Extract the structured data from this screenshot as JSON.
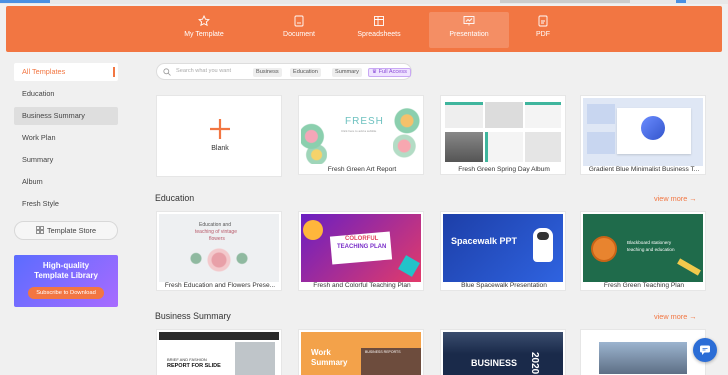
{
  "topbar": {
    "tabs": [
      {
        "label": "My Template",
        "icon": "star-icon"
      },
      {
        "label": "Document",
        "icon": "document-icon"
      },
      {
        "label": "Spreadsheets",
        "icon": "spreadsheet-icon"
      },
      {
        "label": "Presentation",
        "icon": "presentation-icon",
        "active": true
      },
      {
        "label": "PDF",
        "icon": "pdf-icon"
      }
    ],
    "color": "#f27642"
  },
  "sidebar": {
    "items": [
      {
        "label": "All Templates",
        "active": true
      },
      {
        "label": "Education"
      },
      {
        "label": "Business Summary",
        "hover": true
      },
      {
        "label": "Work Plan"
      },
      {
        "label": "Summary"
      },
      {
        "label": "Album"
      },
      {
        "label": "Fresh Style"
      }
    ],
    "store_label": "Template Store",
    "promo": {
      "line1": "High-quality",
      "line2": "Template Library",
      "button": "Subscribe to Download"
    }
  },
  "search": {
    "placeholder": "Search what you want",
    "chips": [
      "Business",
      "Education",
      "Summary"
    ],
    "full_access": "Full Access"
  },
  "row1": [
    {
      "caption": "Blank"
    },
    {
      "caption": "Fresh Green Art Report",
      "title": "FRESH",
      "sub": "Click here to add a subtitle"
    },
    {
      "caption": "Fresh Green Spring Day Album"
    },
    {
      "caption": "Gradient Blue Minimalist Business T..."
    }
  ],
  "education": {
    "title": "Education",
    "more": "view more",
    "cards": [
      {
        "caption": "Fresh Education and Flowers Prese...",
        "l1": "Education and",
        "l2": "teaching of vintage",
        "l3": "flowers"
      },
      {
        "caption": "Fresh and Colorful Teaching Plan",
        "l1": "COLORFUL",
        "l2": "TEACHING PLAN"
      },
      {
        "caption": "Blue Spacewalk Presentation",
        "l1": "Spacewalk PPT"
      },
      {
        "caption": "Fresh Green Teaching Plan",
        "l1": "Blackboard stationery",
        "l2": "teaching and education"
      }
    ]
  },
  "business": {
    "title": "Business Summary",
    "more": "view more",
    "cards": [
      {
        "l1": "BRIEF AND FASHION",
        "l2": "REPORT FOR SLIDE"
      },
      {
        "l1": "Work",
        "l2": "Summary",
        "l3": "BUSINESS REPORTS"
      },
      {
        "l1": "BUSINESS",
        "l2": "2020"
      },
      {
        "l1": ""
      }
    ]
  }
}
